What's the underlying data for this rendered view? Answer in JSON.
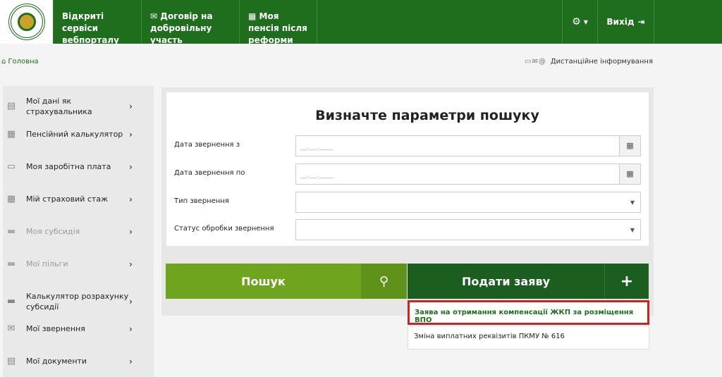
{
  "header": {
    "nav": [
      {
        "label": "Відкриті сервіси вебпорталу"
      },
      {
        "icon": "envelope-icon",
        "label": "Договір на добровільну участь"
      },
      {
        "icon": "calculator-icon",
        "label": "Моя пенсія після реформи"
      }
    ],
    "settings_icon": "gear-icon",
    "exit_label": "Вихід",
    "exit_icon": "sign-out-icon"
  },
  "breadcrumb": {
    "home": "Головна"
  },
  "remote_info": {
    "label": "Дистанційне інформування",
    "icons": [
      "monitor-icon",
      "envelope-icon",
      "at-icon"
    ]
  },
  "sidebar": {
    "items": [
      {
        "label": "Мої дані як страхувальника",
        "icon": "document-icon",
        "enabled": true
      },
      {
        "label": "Пенсійний калькулятор",
        "icon": "calculator-icon",
        "enabled": true
      },
      {
        "label": "Моя заробітна плата",
        "icon": "wallet-icon",
        "enabled": true
      },
      {
        "label": "Мій страховий стаж",
        "icon": "calendar-icon",
        "enabled": true
      },
      {
        "label": "Моя субсидія",
        "icon": "folder-icon",
        "enabled": false
      },
      {
        "label": "Мої пільги",
        "icon": "folder-icon",
        "enabled": false
      },
      {
        "label": "Калькулятор розрахунку субсидії",
        "icon": "folder-icon",
        "enabled": true
      },
      {
        "label": "Мої звернення",
        "icon": "envelope-icon",
        "enabled": true
      },
      {
        "label": "Мої документи",
        "icon": "document-icon",
        "enabled": true
      }
    ]
  },
  "search": {
    "title": "Визначте параметри пошуку",
    "fields": [
      {
        "label": "Дата звернення з",
        "placeholder": "__.__.____"
      },
      {
        "label": "Дата звернення по",
        "placeholder": "__.__.____"
      },
      {
        "label": "Тип звернення",
        "value": ""
      },
      {
        "label": "Статус обробки звернення",
        "value": ""
      }
    ],
    "search_button": "Пошук",
    "apply_button": "Подати заяву",
    "apply_plus": "+"
  },
  "apply_menu": [
    {
      "label": "Заява на отримання компенсації ЖКП за розміщення ВПО",
      "highlighted": true
    },
    {
      "label": "Зміна виплатних реквізитів ПКМУ № 616",
      "highlighted": false
    }
  ],
  "colors": {
    "header_green": "#1e6e1e",
    "search_green": "#6fa51e",
    "apply_green": "#1b5e20",
    "highlight_red": "#d32020"
  }
}
